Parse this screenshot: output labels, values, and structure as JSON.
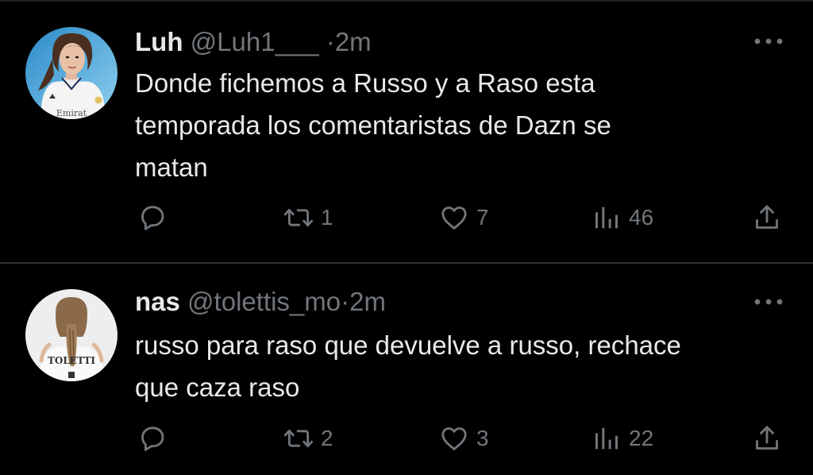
{
  "tweets": [
    {
      "name": "Luh",
      "handle": "@Luh1___",
      "dot": "·",
      "time": "2m",
      "text_lines": [
        "Donde fichemos a Russo y a Raso esta",
        "temporada los comentaristas de Dazn se",
        "matan"
      ],
      "avatar_text": "Emirat",
      "retweets": "1",
      "likes": "7",
      "views": "46"
    },
    {
      "name": "nas",
      "handle": "@tolettis_mo",
      "dot": "·",
      "time": "2m",
      "text_lines": [
        "russo para raso que devuelve a russo, rechace",
        "que caza raso"
      ],
      "avatar_text": "TOLETTI",
      "retweets": "2",
      "likes": "3",
      "views": "22"
    }
  ],
  "icons": {
    "more": "more-horizontal-icon",
    "reply": "reply-icon",
    "retweet": "retweet-icon",
    "like": "heart-icon",
    "views": "analytics-icon",
    "share": "share-icon"
  },
  "colors": {
    "background": "#000000",
    "text": "#e7e9ea",
    "secondary": "#71767b",
    "divider": "#2f3336"
  }
}
